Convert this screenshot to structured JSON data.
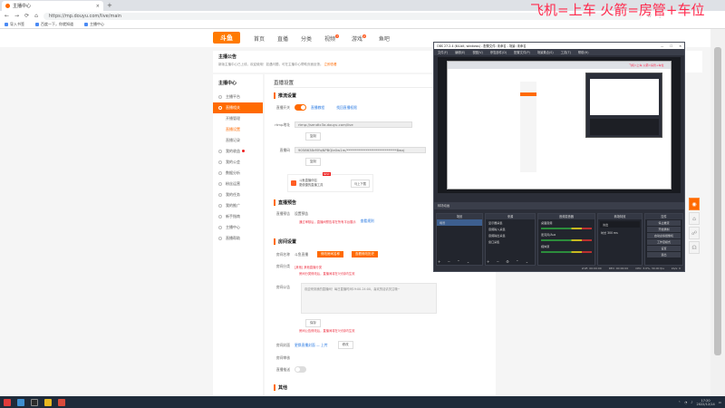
{
  "browser": {
    "tab_title": "主播中心",
    "url": "https://mp.douyu.com/live/main",
    "bookmarks": [
      "导入书签",
      "百度一下，你就知道",
      "主播中心"
    ]
  },
  "header": {
    "logo_text": "斗鱼",
    "nav": [
      "首页",
      "直播",
      "分类",
      "视频",
      "游戏",
      "鱼吧"
    ],
    "badges": {
      "video": "7",
      "game": "2"
    }
  },
  "notice": {
    "title": "主播公告",
    "body": "新版主播中心已上线，欢迎使用！如遇问题，可在主播中心帮助页面反馈。",
    "link": "立即查看"
  },
  "sidebar": {
    "title": "主播中心",
    "items": [
      {
        "label": "主播平台",
        "active": false
      },
      {
        "label": "直播相关",
        "active": true
      },
      {
        "label": "开播管理",
        "sub": true
      },
      {
        "label": "直播设置",
        "sub": true,
        "current": true
      },
      {
        "label": "直播记录",
        "sub": true
      },
      {
        "label": "我的收益",
        "dot": true
      },
      {
        "label": "我的公会"
      },
      {
        "label": "数据分析"
      },
      {
        "label": "粉丝运营"
      },
      {
        "label": "我的任务"
      },
      {
        "label": "我的推广"
      },
      {
        "label": "新手指南"
      },
      {
        "label": "主播中心"
      },
      {
        "label": "直播帮助"
      }
    ]
  },
  "main": {
    "title": "直播设置",
    "push": {
      "section": "推流设置",
      "switch_label": "直播开关",
      "link1": "直播教程",
      "link2": "找回直播权限",
      "rtmp_label": "rtmp地址",
      "rtmp_value": "rtmp://sendtc3a.douyu.com/live",
      "copy": "复制",
      "code_label": "直播码",
      "code_value": "9058638rMYqNPBQIe0w1m/*****************************8wxj",
      "promo_title": "斗鱼直播伴侣",
      "promo_sub": "更便捷的直播工具",
      "promo_new": "NEW",
      "promo_btn": "马上下载"
    },
    "preview": {
      "section": "直播预告",
      "label": "直播预告",
      "value": "设置预告",
      "note": "通过审核后，直播间预告将在所有平台展示",
      "note_link": "查看规则"
    },
    "room": {
      "section": "房间设置",
      "name_label": "房间名称",
      "name_value": "斗鱼直播",
      "btn_rename": "修改房间名称",
      "btn_history": "查看修改历史",
      "cat_label": "房间分类",
      "cat_value": "[其他] 其他直播分类",
      "cat_note": "房间分类修改后，直播间将在5分钟内生效",
      "announce_label": "房间公告",
      "announce_value": "欢迎来到我的直播间！每日直播时间19:00-24:00，喜欢的话请关注哦~",
      "save": "保存",
      "announce_note": "房间公告修改后，直播间将在5分钟内生效",
      "cover_label": "房间封面",
      "cover_value": "更换直播封面 — 上传",
      "cover_btn": "修改",
      "check_label": "房间审核",
      "push_label": "直播推送"
    },
    "other": {
      "section": "其他"
    }
  },
  "obs": {
    "title": "OBS 27.2.4 (64-bit, windows) - 配置文件: 未命名 - 场景: 未命名",
    "menu": [
      "文件(F)",
      "编辑(E)",
      "视图(V)",
      "停靠部件(D)",
      "配置文件(P)",
      "场景集合(S)",
      "工具(T)",
      "帮助(H)"
    ],
    "subbar": "转场动画",
    "docks": {
      "scenes": {
        "title": "场景",
        "items": [
          "场景"
        ]
      },
      "sources": {
        "title": "来源",
        "items": [
          "显示器采集",
          "音频输入采集",
          "音频输出采集",
          "窗口采集"
        ]
      },
      "mixer": {
        "title": "音频混音器",
        "items": [
          "桌面音频",
          "麦克风/Aux",
          "媒体源"
        ]
      },
      "transition": {
        "title": "转场特效",
        "items": [
          "淡出",
          "时长 300 ms"
        ]
      },
      "controls": {
        "title": "控件",
        "items": [
          "停止推流",
          "开始录制",
          "启动虚拟摄像机",
          "工作室模式",
          "设置",
          "退出"
        ]
      }
    },
    "status": [
      "LIVE: 00:00:00",
      "REC: 00:00:00",
      "CPU: 3.0%, 30.00 fps",
      "kb/s: 0"
    ]
  },
  "overlay": {
    "text": "飞机=上车  火箭=房管+车位"
  },
  "taskbar": {
    "time": "17:20",
    "date": "2022/12/14"
  }
}
